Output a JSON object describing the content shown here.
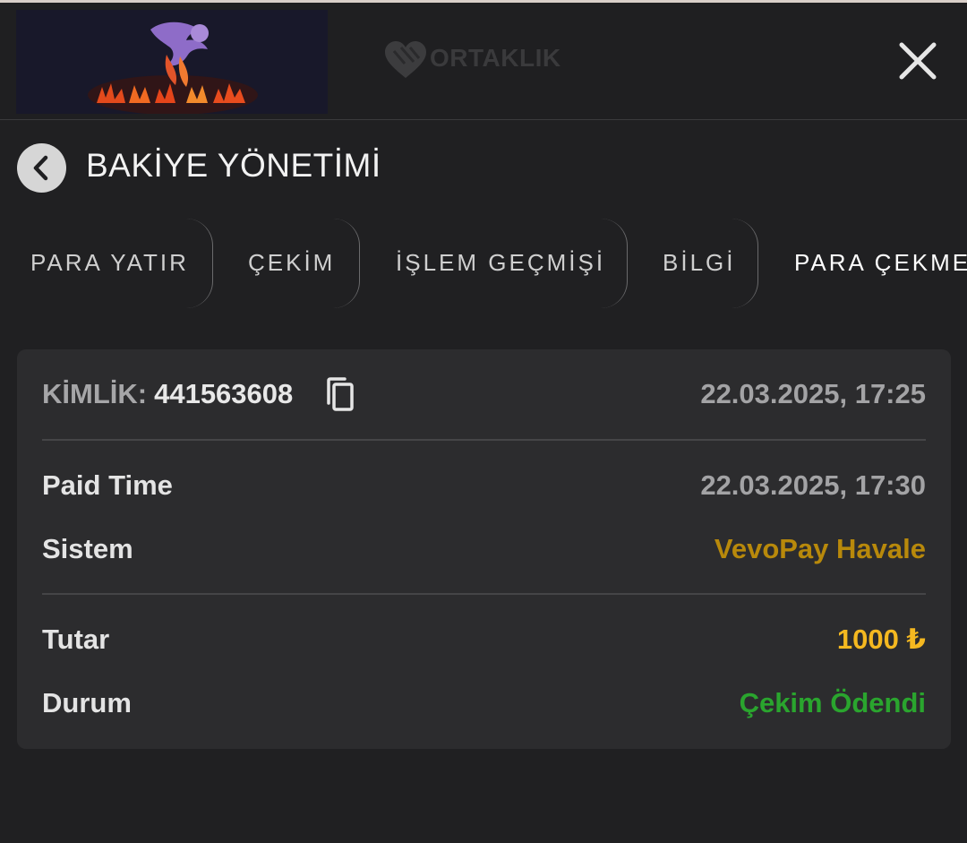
{
  "header": {
    "brand_logo_icon": "phoenix-fire-logo",
    "partner_logo_text": "ORTAKLIK",
    "close_icon": "close-icon"
  },
  "page": {
    "title": "BAKİYE YÖNETİMİ",
    "back_icon": "chevron-left-icon"
  },
  "tabs": [
    {
      "label": "PARA YATIR"
    },
    {
      "label": "ÇEKİM"
    },
    {
      "label": "İŞLEM GEÇMİŞİ"
    },
    {
      "label": "BİLGİ"
    },
    {
      "label": "PARA ÇEKME"
    }
  ],
  "transaction": {
    "id_label": "KİMLİK:",
    "id_value": "441563608",
    "created": "22.03.2025, 17:25",
    "paid_time_label": "Paid Time",
    "paid_time_value": "22.03.2025, 17:30",
    "system_label": "Sistem",
    "system_value": "VevoPay Havale",
    "amount_label": "Tutar",
    "amount_value": "1000 ₺",
    "status_label": "Durum",
    "status_value": "Çekim Ödendi"
  },
  "colors": {
    "system": "#b8890b",
    "amount": "#f4b820",
    "status": "#2aa52e",
    "card_bg": "#2c2c2e",
    "page_bg": "#202022"
  }
}
